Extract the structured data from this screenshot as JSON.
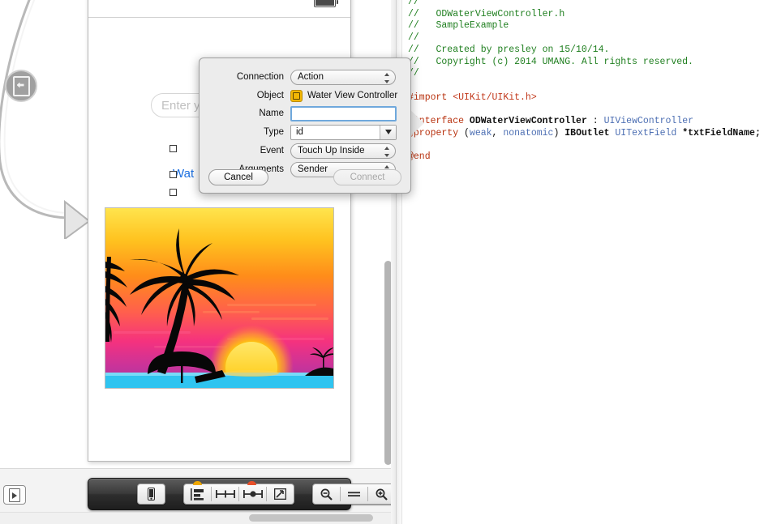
{
  "canvas": {
    "scene": {
      "text_field_placeholder": "Enter yo",
      "button_label": "Wat",
      "battery_icon": "battery-icon",
      "image_name": "tropical-sunset-palm-trees"
    },
    "badge_icon": "view-controller-badge-icon",
    "segue_icon": "segue-arrow-icon"
  },
  "popover": {
    "rows": [
      {
        "label": "Connection",
        "value": "Action",
        "control": "popup"
      },
      {
        "label": "Object",
        "value": "Water View Controller",
        "control": "object"
      },
      {
        "label": "Name",
        "value": "",
        "control": "input"
      },
      {
        "label": "Type",
        "value": "id",
        "control": "combo"
      },
      {
        "label": "Event",
        "value": "Touch Up Inside",
        "control": "popup"
      },
      {
        "label": "Arguments",
        "value": "Sender",
        "control": "popup"
      }
    ],
    "cancel_label": "Cancel",
    "connect_label": "Connect",
    "object_icon": "view-controller-object-icon",
    "accent_focus": "#6fa8dc",
    "object_icon_color": "#f2b705"
  },
  "toolbar": {
    "filter_button_icon": "filter-document-icon",
    "buttons": [
      {
        "icon": "device-preview-icon",
        "group": 0
      },
      {
        "icon": "align-constraints-icon",
        "group": 1
      },
      {
        "icon": "pin-constraints-icon",
        "group": 1
      },
      {
        "icon": "resolve-issues-icon",
        "group": 1
      },
      {
        "icon": "resizing-behavior-icon",
        "group": 1
      },
      {
        "icon": "zoom-out-icon",
        "group": 2
      },
      {
        "icon": "zoom-actual-icon",
        "group": 2
      },
      {
        "icon": "zoom-in-icon",
        "group": 2
      }
    ]
  },
  "code": {
    "lines": [
      [
        {
          "t": "//",
          "c": "comment"
        }
      ],
      [
        {
          "t": "//   ODWaterViewController.h",
          "c": "comment"
        }
      ],
      [
        {
          "t": "//   SampleExample",
          "c": "comment"
        }
      ],
      [
        {
          "t": "//",
          "c": "comment"
        }
      ],
      [
        {
          "t": "//   Created by presley on 15/10/14.",
          "c": "comment"
        }
      ],
      [
        {
          "t": "//   Copyright (c) 2014 UMANG. All rights reserved.",
          "c": "comment"
        }
      ],
      [
        {
          "t": "//",
          "c": "comment"
        }
      ],
      [
        {
          "t": "",
          "c": "plain"
        }
      ],
      [
        {
          "t": "#import ",
          "c": "pre-kw"
        },
        {
          "t": "<UIKit/UIKit.h>",
          "c": "pre"
        }
      ],
      [
        {
          "t": "",
          "c": "plain"
        }
      ],
      [
        {
          "t": "@interface ",
          "c": "kw"
        },
        {
          "t": "ODWaterViewController",
          "c": "ident"
        },
        {
          "t": " : ",
          "c": "plain"
        },
        {
          "t": "UIViewController",
          "c": "type"
        }
      ],
      [
        {
          "t": "@property ",
          "c": "kw"
        },
        {
          "t": "(",
          "c": "plain"
        },
        {
          "t": "weak",
          "c": "type"
        },
        {
          "t": ", ",
          "c": "plain"
        },
        {
          "t": "nonatomic",
          "c": "type"
        },
        {
          "t": ") ",
          "c": "plain"
        },
        {
          "t": "IBOutlet ",
          "c": "ident"
        },
        {
          "t": "UITextField",
          "c": "type"
        },
        {
          "t": " *txtFieldName;",
          "c": "ident"
        }
      ],
      [
        {
          "t": "",
          "c": "plain"
        }
      ],
      [
        {
          "t": "@end",
          "c": "kw"
        }
      ]
    ]
  }
}
